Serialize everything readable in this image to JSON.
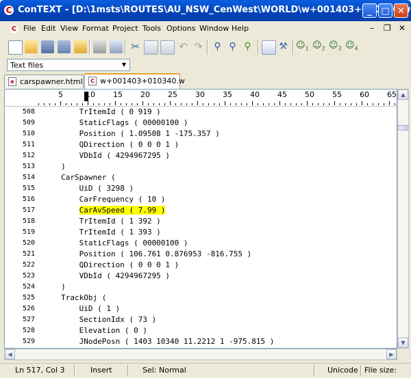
{
  "window": {
    "title": "ConTEXT - [D:\\1msts\\ROUTES\\AU_NSW_CenWest\\WORLD\\w+001403+010340.w]",
    "minimize_label": "_",
    "maximize_label": "□",
    "close_label": "✕"
  },
  "menu": {
    "items": [
      "File",
      "Edit",
      "View",
      "Format",
      "Project",
      "Tools",
      "Options",
      "Window",
      "Help"
    ]
  },
  "toolbar": {
    "user_commands": [
      "1",
      "2",
      "3",
      "4"
    ]
  },
  "filter": {
    "value": "Text files"
  },
  "tabs": [
    {
      "label": "carspawner.html *"
    },
    {
      "label": "w+001403+010340.w"
    }
  ],
  "ruler": {
    "labels": [
      "5",
      "10",
      "15",
      "20",
      "25",
      "30",
      "35",
      "40",
      "45",
      "50",
      "55",
      "60",
      "65"
    ]
  },
  "editor": {
    "lines": [
      {
        "num": "508",
        "text": "         TrItemId ( 0 919 )"
      },
      {
        "num": "509",
        "text": "         StaticFlags ( 00000100 )"
      },
      {
        "num": "510",
        "text": "         Position ( 1.09508 1 -175.357 )"
      },
      {
        "num": "511",
        "text": "         QDirection ( 0 0 0 1 )"
      },
      {
        "num": "512",
        "text": "         VDbId ( 4294967295 )"
      },
      {
        "num": "513",
        "text": "     )"
      },
      {
        "num": "514",
        "text": "     CarSpawner ("
      },
      {
        "num": "515",
        "text": "         UiD ( 3298 )"
      },
      {
        "num": "516",
        "text": "         CarFrequency ( 10 )"
      },
      {
        "num": "517",
        "text": "         CarAvSpeed ( 7.99 )",
        "highlight": true
      },
      {
        "num": "518",
        "text": "         TrItemId ( 1 392 )"
      },
      {
        "num": "519",
        "text": "         TrItemId ( 1 393 )"
      },
      {
        "num": "520",
        "text": "         StaticFlags ( 00000100 )"
      },
      {
        "num": "521",
        "text": "         Position ( 106.761 0.876953 -816.755 )"
      },
      {
        "num": "522",
        "text": "         QDirection ( 0 0 0 1 )"
      },
      {
        "num": "523",
        "text": "         VDbId ( 4294967295 )"
      },
      {
        "num": "524",
        "text": "     )"
      },
      {
        "num": "525",
        "text": "     TrackObj ("
      },
      {
        "num": "526",
        "text": "         UiD ( 1 )"
      },
      {
        "num": "527",
        "text": "         SectionIdx ( 73 )"
      },
      {
        "num": "528",
        "text": "         Elevation ( 0 )"
      },
      {
        "num": "529",
        "text": "         JNodePosn ( 1403 10340 11.2212 1 -975.815 )"
      }
    ]
  },
  "status": {
    "position": "Ln 517, Col 3",
    "mode": "Insert",
    "selection": "Sel: Normal",
    "encoding": "Unicode",
    "filesize": "File size:"
  }
}
